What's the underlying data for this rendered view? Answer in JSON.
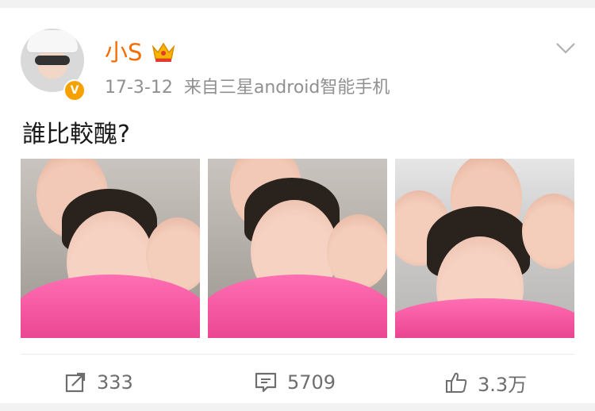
{
  "post": {
    "author": "小S",
    "time": "17-3-12",
    "source": "来自三星android智能手机",
    "text": "誰比較醜?",
    "images": [
      {
        "alt": "selfie-1"
      },
      {
        "alt": "selfie-2"
      },
      {
        "alt": "selfie-3"
      }
    ]
  },
  "actions": {
    "repost_count": "333",
    "comment_count": "5709",
    "like_count": "3.3万"
  },
  "colors": {
    "name": "#f56b00",
    "meta": "#909090",
    "verified_badge": "#f7a100",
    "icon": "#6e6e6e"
  },
  "icons": {
    "verified": "v-badge-icon",
    "crown": "crown-icon",
    "more": "chevron-down-icon",
    "repost": "repost-icon",
    "comment": "comment-icon",
    "like": "thumbs-up-icon"
  }
}
